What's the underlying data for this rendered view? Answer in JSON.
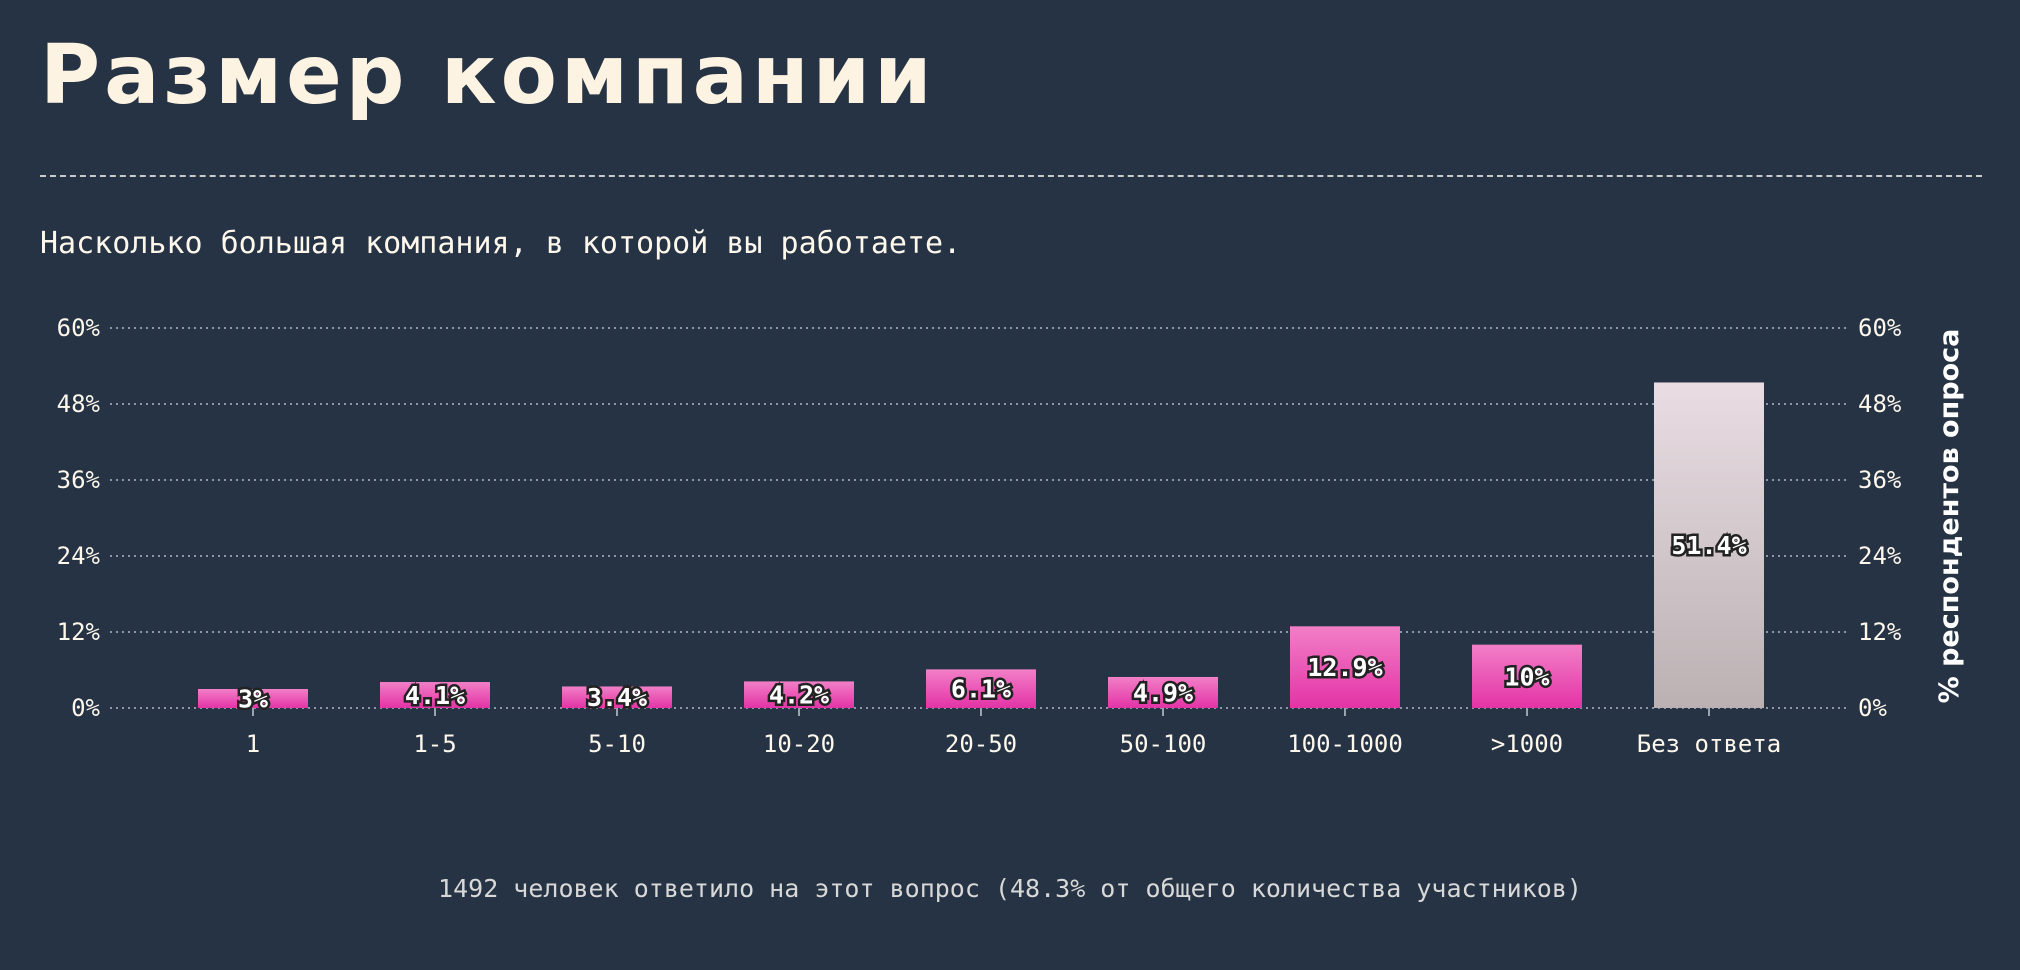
{
  "page": {
    "title": "Размер компании",
    "subtitle": "Насколько большая компания, в которой вы работаете.",
    "footer": "1492 человек ответило на этот вопрос (48.3% от общего количества участников)"
  },
  "colors": {
    "background": "#253344",
    "bar_primary_top": "#f27fc7",
    "bar_primary_bottom": "#e333a6",
    "bar_secondary_top": "#e9dde3",
    "bar_secondary_bottom": "#bbb1b3",
    "grid": "#8e97a3"
  },
  "chart_data": {
    "type": "bar",
    "categories": [
      "1",
      "1-5",
      "5-10",
      "10-20",
      "20-50",
      "50-100",
      "100-1000",
      ">1000",
      "Без ответа"
    ],
    "values": [
      3,
      4.1,
      3.4,
      4.2,
      6.1,
      4.9,
      12.9,
      10,
      51.4
    ],
    "value_labels": [
      "3%",
      "4.1%",
      "3.4%",
      "4.2%",
      "6.1%",
      "4.9%",
      "12.9%",
      "10%",
      "51.4%"
    ],
    "ylim": [
      0,
      60
    ],
    "yticks": [
      0,
      12,
      24,
      36,
      48,
      60
    ],
    "ytick_labels": [
      "0%",
      "12%",
      "24%",
      "36%",
      "48%",
      "60%"
    ],
    "ylabel": "% респондентов опроса",
    "xlabel": "",
    "grid": true,
    "highlight_category": "Без ответа"
  }
}
